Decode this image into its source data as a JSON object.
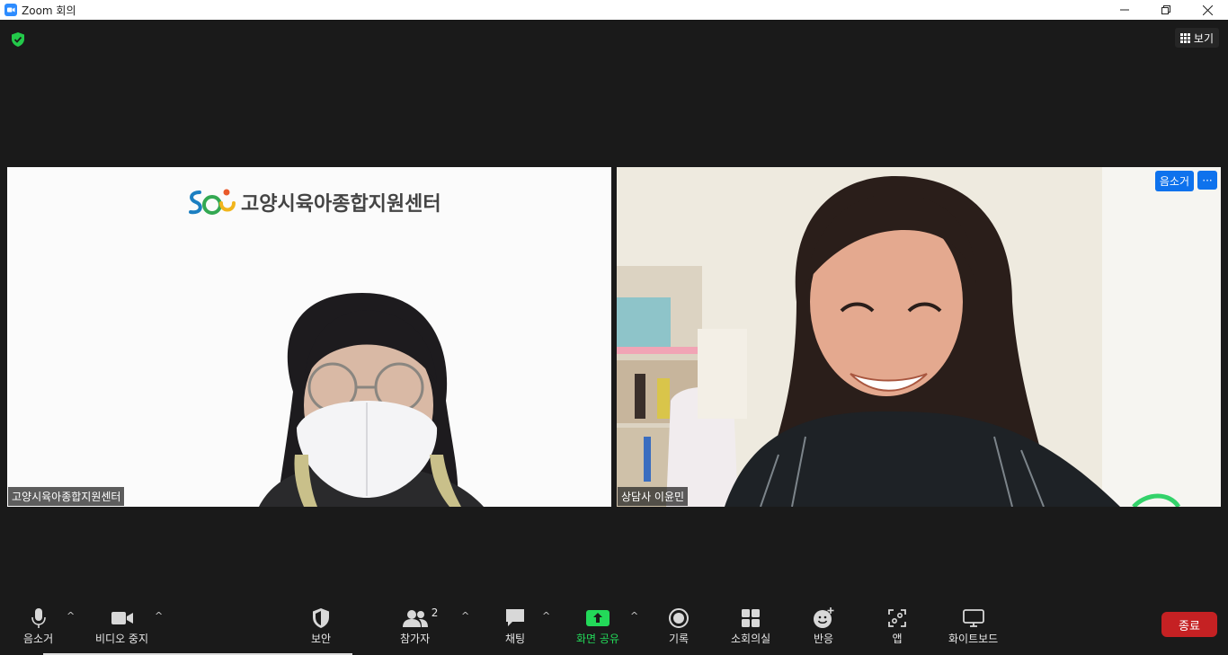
{
  "window": {
    "title": "Zoom 회의",
    "minimize_icon": "minimize-icon",
    "restore_icon": "restore-icon",
    "close_icon": "close-icon"
  },
  "meeting": {
    "view_label": "보기",
    "participants": [
      {
        "name": "고양시육아종합지원센터",
        "logo_text": "고양시육아종합지원센터"
      },
      {
        "name": "상담사 이윤민",
        "mute_label": "음소거",
        "more_label": "···"
      }
    ]
  },
  "toolbar": {
    "mute": "음소거",
    "video": "비디오 중지",
    "security": "보안",
    "participants": "참가자",
    "participant_count": "2",
    "chat": "채팅",
    "share": "화면 공유",
    "record": "기록",
    "breakout": "소회의실",
    "reactions": "반응",
    "apps": "앱",
    "whiteboard": "화이트보드",
    "end": "종료",
    "caret": "^"
  },
  "colors": {
    "accent_blue": "#0e72ed",
    "share_green": "#23d959",
    "end_red": "#c52123",
    "shield_green": "#23c94a"
  }
}
